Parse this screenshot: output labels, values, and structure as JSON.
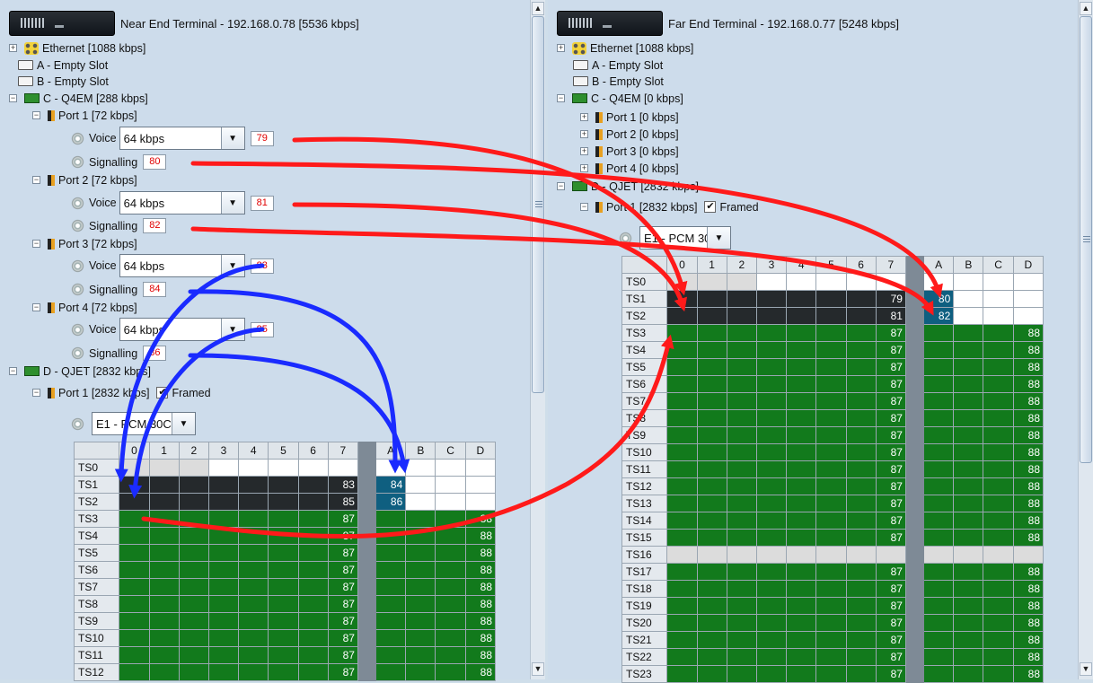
{
  "near": {
    "title": "Near End Terminal - 192.168.0.78 [5536 kbps]",
    "ethernet": "Ethernet [1088 kbps]",
    "slot_a": "A - Empty Slot",
    "slot_b": "B - Empty Slot",
    "card_c": "C - Q4EM [288 kbps]",
    "ports": [
      {
        "label": "Port 1 [72 kbps]",
        "voice_label": "Voice",
        "voice_value": "64 kbps",
        "voice_ts": "79",
        "sig_label": "Signalling",
        "sig_ts": "80"
      },
      {
        "label": "Port 2 [72 kbps]",
        "voice_label": "Voice",
        "voice_value": "64 kbps",
        "voice_ts": "81",
        "sig_label": "Signalling",
        "sig_ts": "82"
      },
      {
        "label": "Port 3 [72 kbps]",
        "voice_label": "Voice",
        "voice_value": "64 kbps",
        "voice_ts": "83",
        "sig_label": "Signalling",
        "sig_ts": "84"
      },
      {
        "label": "Port 4 [72 kbps]",
        "voice_label": "Voice",
        "voice_value": "64 kbps",
        "voice_ts": "85",
        "sig_label": "Signalling",
        "sig_ts": "86"
      }
    ],
    "card_d": "D - QJET [2832 kbps]",
    "qjet_port": "Port 1 [2832 kbps]",
    "framed_label": "Framed",
    "framing": "E1 - PCM 30C",
    "columns": [
      "0",
      "1",
      "2",
      "3",
      "4",
      "5",
      "6",
      "7",
      "",
      "A",
      "B",
      "C",
      "D"
    ],
    "rows": [
      "TS0",
      "TS1",
      "TS2",
      "TS3",
      "TS4",
      "TS5",
      "TS6",
      "TS7",
      "TS8",
      "TS9",
      "TS10",
      "TS11",
      "TS12"
    ],
    "ts1_col7": "83",
    "ts1_colA": "84",
    "ts2_col7": "85",
    "ts2_colA": "86",
    "data_col7": "87",
    "data_colD": "88"
  },
  "far": {
    "title": "Far End Terminal - 192.168.0.77 [5248 kbps]",
    "ethernet": "Ethernet [1088 kbps]",
    "slot_a": "A - Empty Slot",
    "slot_b": "B - Empty Slot",
    "card_c": "C - Q4EM [0 kbps]",
    "ports": [
      "Port 1 [0 kbps]",
      "Port 2 [0 kbps]",
      "Port 3 [0 kbps]",
      "Port 4 [0 kbps]"
    ],
    "card_d": "D - QJET [2832 kbps]",
    "qjet_port": "Port 1 [2832 kbps]",
    "framed_label": "Framed",
    "framing": "E1 - PCM 30C",
    "columns": [
      "0",
      "1",
      "2",
      "3",
      "4",
      "5",
      "6",
      "7",
      "",
      "A",
      "B",
      "C",
      "D"
    ],
    "rows": [
      "TS0",
      "TS1",
      "TS2",
      "TS3",
      "TS4",
      "TS5",
      "TS6",
      "TS7",
      "TS8",
      "TS9",
      "TS10",
      "TS11",
      "TS12",
      "TS13",
      "TS14",
      "TS15",
      "TS16",
      "TS17",
      "TS18",
      "TS19",
      "TS20",
      "TS21",
      "TS22",
      "TS23"
    ],
    "ts1_col7": "79",
    "ts1_colA": "80",
    "ts2_col7": "81",
    "ts2_colA": "82",
    "data_col7": "87",
    "data_colD": "88"
  },
  "colors": {
    "arrow_red": "#ff1a1a",
    "arrow_blue": "#1a2bff",
    "green": "#127a1c",
    "black": "#25292c",
    "blue_cell": "#0f5f80"
  },
  "icons": {
    "device": "device-icon",
    "ethernet": "ethernet-icon",
    "slot": "empty-slot-icon",
    "card": "card-icon",
    "port": "port-icon",
    "gear": "gear-icon"
  }
}
